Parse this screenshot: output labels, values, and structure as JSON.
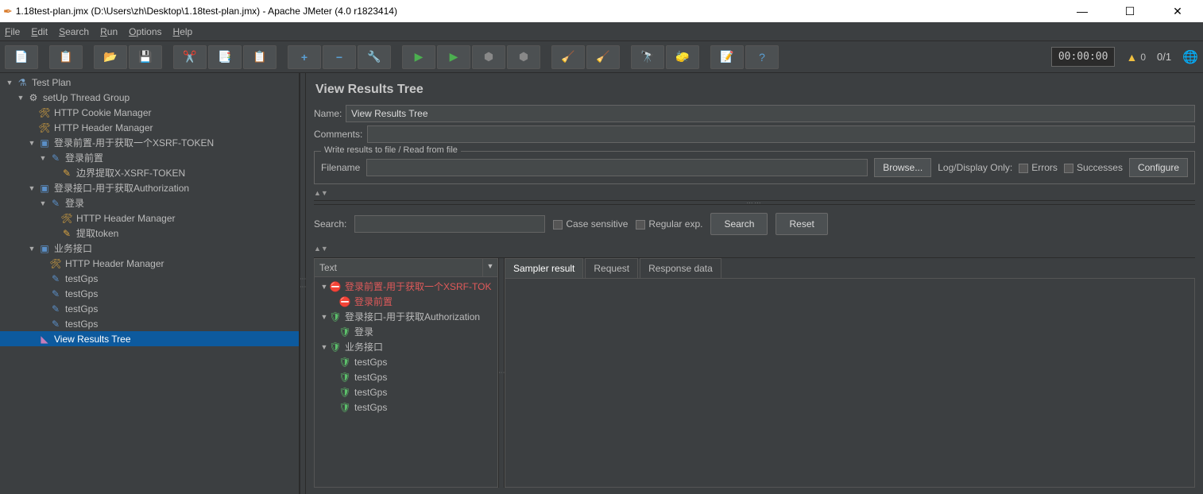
{
  "window": {
    "title": "1.18test-plan.jmx (D:\\Users\\zh\\Desktop\\1.18test-plan.jmx) - Apache JMeter (4.0 r1823414)"
  },
  "menu": {
    "file": "File",
    "edit": "Edit",
    "search": "Search",
    "run": "Run",
    "options": "Options",
    "help": "Help"
  },
  "toolbar": {
    "timer": "00:00:00",
    "warn_count": "0",
    "threads": "0/1"
  },
  "tree": {
    "n0": "Test Plan",
    "n1": "setUp Thread Group",
    "n2": "HTTP Cookie Manager",
    "n3": "HTTP Header Manager",
    "n4": "登录前置-用于获取一个XSRF-TOKEN",
    "n5": "登录前置",
    "n6": "边界提取X-XSRF-TOKEN",
    "n7": "登录接口-用于获取Authorization",
    "n8": "登录",
    "n9": "HTTP Header Manager",
    "n10": "提取token",
    "n11": "业务接口",
    "n12": "HTTP Header Manager",
    "n13": "testGps",
    "n14": "testGps",
    "n15": "testGps",
    "n16": "testGps",
    "n17": "View Results Tree"
  },
  "panel": {
    "title": "View Results Tree",
    "name_label": "Name:",
    "name_value": "View Results Tree",
    "comments_label": "Comments:",
    "fieldset_legend": "Write results to file / Read from file",
    "filename_label": "Filename",
    "browse": "Browse...",
    "logdisplay": "Log/Display Only:",
    "errors": "Errors",
    "successes": "Successes",
    "configure": "Configure",
    "search_label": "Search:",
    "case_sensitive": "Case sensitive",
    "regex": "Regular exp.",
    "search_btn": "Search",
    "reset_btn": "Reset",
    "tree_header": "Text",
    "tab_sampler": "Sampler result",
    "tab_request": "Request",
    "tab_response": "Response data"
  },
  "results": {
    "r0": "登录前置-用于获取一个XSRF-TOK",
    "r1": "登录前置",
    "r2": "登录接口-用于获取Authorization",
    "r3": "登录",
    "r4": "业务接口",
    "r5": "testGps",
    "r6": "testGps",
    "r7": "testGps",
    "r8": "testGps"
  }
}
